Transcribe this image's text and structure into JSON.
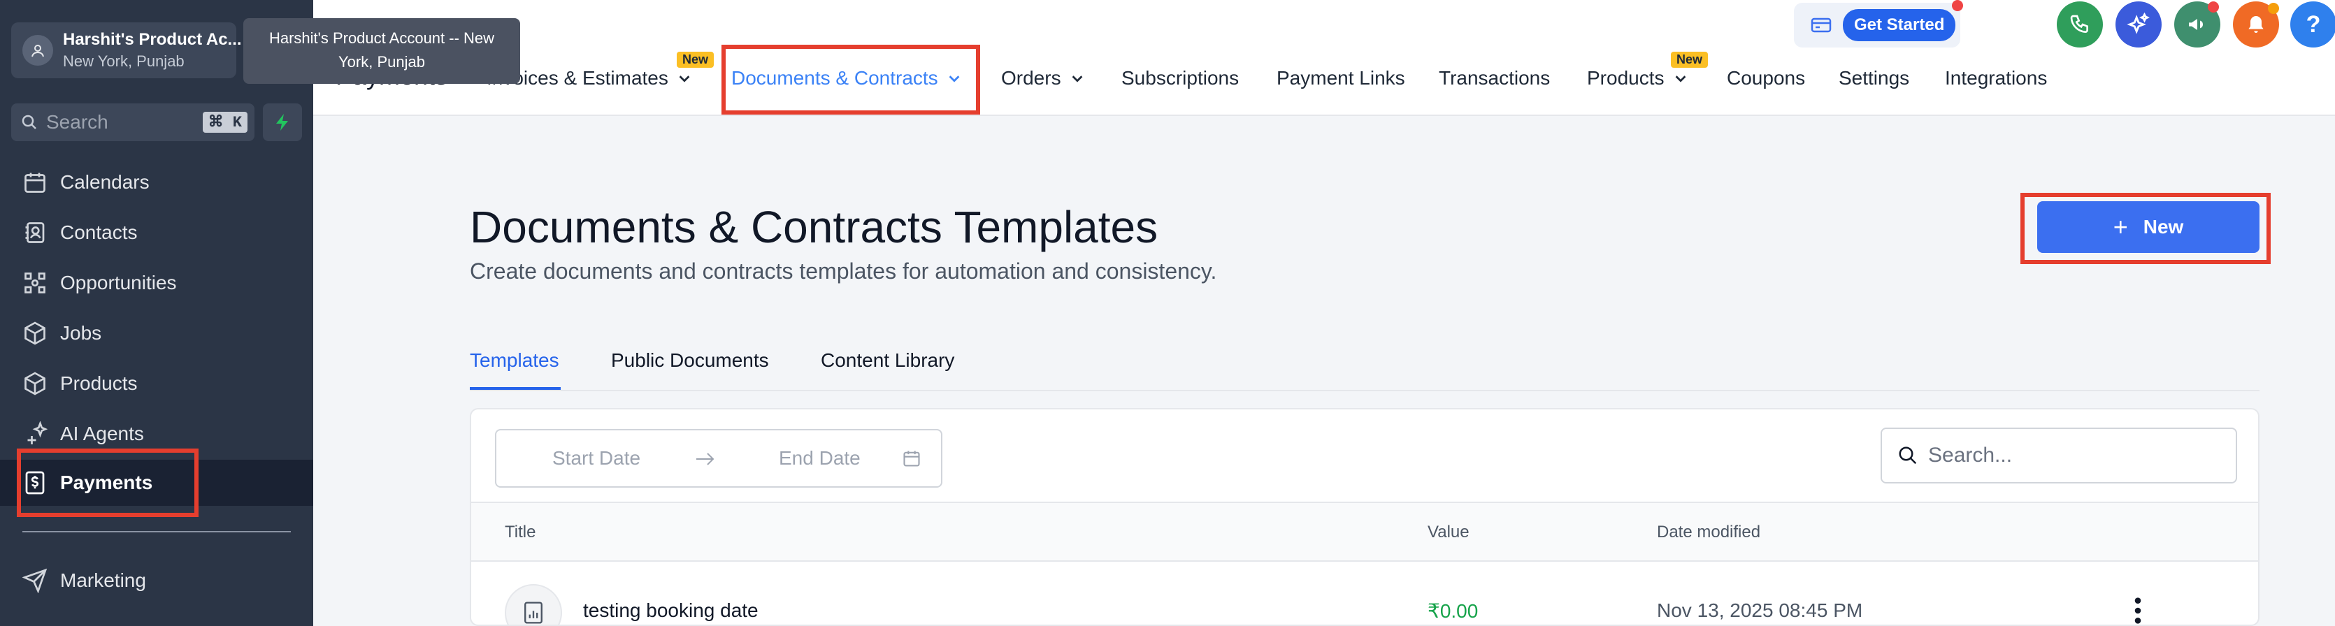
{
  "account": {
    "name": "Harshit's Product Ac...",
    "location": "New York, Punjab",
    "tooltip": "Harshit's Product Account -- New York, Punjab"
  },
  "sidebar": {
    "search_placeholder": "Search",
    "shortcut": "⌘ K",
    "items": [
      {
        "label": "Calendars",
        "icon": "calendar-icon"
      },
      {
        "label": "Contacts",
        "icon": "contacts-icon"
      },
      {
        "label": "Opportunities",
        "icon": "opportunities-icon"
      },
      {
        "label": "Jobs",
        "icon": "box-icon"
      },
      {
        "label": "Products",
        "icon": "box-icon"
      },
      {
        "label": "AI Agents",
        "icon": "sparkle-icon"
      },
      {
        "label": "Payments",
        "icon": "payments-icon",
        "active": true
      },
      {
        "label": "Marketing",
        "icon": "send-icon"
      }
    ]
  },
  "header": {
    "page_label": "Payments",
    "tabs": [
      {
        "label": "Invoices & Estimates",
        "badge": "New",
        "dropdown": true
      },
      {
        "label": "Documents & Contracts",
        "dropdown": true,
        "selected": true
      },
      {
        "label": "Orders",
        "dropdown": true
      },
      {
        "label": "Subscriptions"
      },
      {
        "label": "Payment Links"
      },
      {
        "label": "Transactions"
      },
      {
        "label": "Products",
        "badge": "New",
        "dropdown": true
      },
      {
        "label": "Coupons"
      },
      {
        "label": "Settings"
      },
      {
        "label": "Integrations"
      }
    ],
    "get_started": "Get Started"
  },
  "main": {
    "title": "Documents & Contracts Templates",
    "subtitle": "Create documents and contracts templates for automation and consistency.",
    "new_button": "New",
    "content_tabs": [
      "Templates",
      "Public Documents",
      "Content Library"
    ],
    "filters": {
      "start_date": "Start Date",
      "end_date": "End Date",
      "search_placeholder": "Search..."
    },
    "table": {
      "columns": [
        "Title",
        "Value",
        "Date modified"
      ],
      "rows": [
        {
          "title": "testing booking date",
          "value": "₹0.00",
          "date": "Nov 13, 2025 08:45 PM"
        }
      ]
    }
  },
  "colors": {
    "sidebar_bg": "#2b3546",
    "accent": "#3b6ff0",
    "highlight": "#e53e2e"
  }
}
